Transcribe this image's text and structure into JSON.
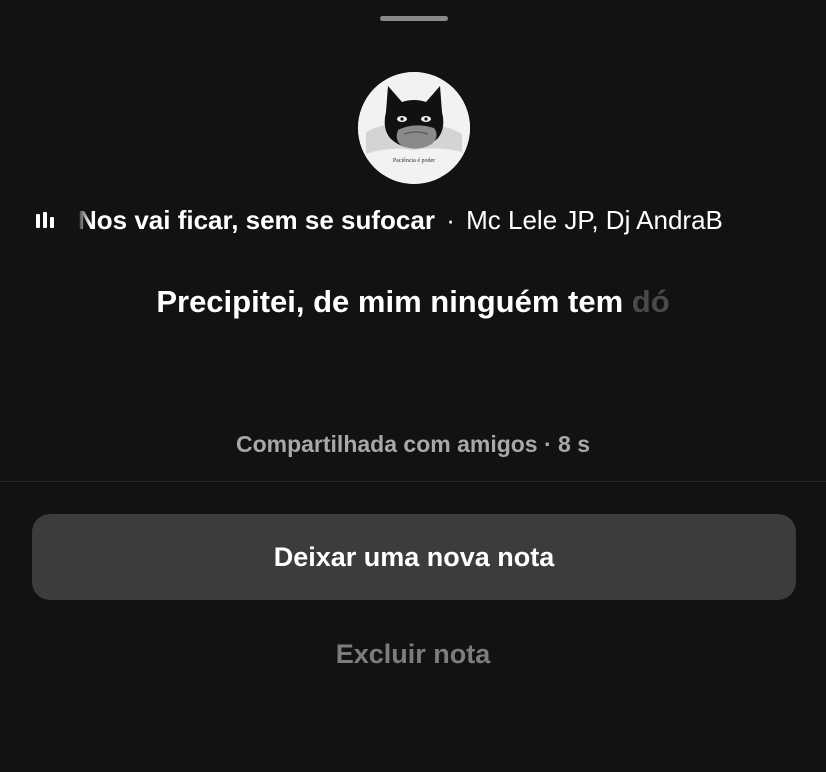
{
  "note": {
    "avatar_icon": "cat-silhouette-avatar",
    "avatar_caption": "Paciência é poder",
    "music": {
      "icon": "equalizer-icon",
      "song_title": "Nos vai ficar, sem se sufocar",
      "separator": "·",
      "artist": "Mc Lele JP, Dj AndraB"
    },
    "lyric": {
      "visible": "Precipitei, de mim ninguém tem",
      "fading": "dó"
    },
    "shared_info": "Compartilhada com amigos · 8 s"
  },
  "actions": {
    "new_note_label": "Deixar uma nova nota",
    "delete_note_label": "Excluir nota"
  },
  "colors": {
    "background": "#121212",
    "primary_button": "#3c3c3c",
    "muted_text": "#a8a8a8",
    "disabled_text": "#7d7d7d"
  }
}
